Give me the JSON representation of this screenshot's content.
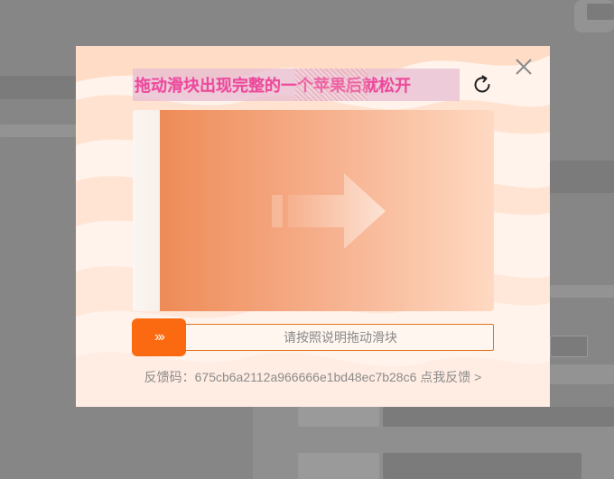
{
  "captcha": {
    "instruction": "拖动滑块出现完整的一个苹果后就松开",
    "slider_hint": "请按照说明拖动滑块",
    "handle_glyph": "›››",
    "feedback_prefix": "反馈码：",
    "feedback_code": "675cb6a2112a966666e1bd48ec7b28c6",
    "feedback_link": "点我反馈 >",
    "icons": {
      "close": "close-icon",
      "refresh": "refresh-icon",
      "arrow": "right-arrow-icon",
      "handle": "chevron-right-icon"
    },
    "colors": {
      "accent": "#fb6a10",
      "instruction_text": "#ec4a9b",
      "puzzle_start": "#ee8b57",
      "puzzle_end": "#ffd9c2"
    }
  }
}
